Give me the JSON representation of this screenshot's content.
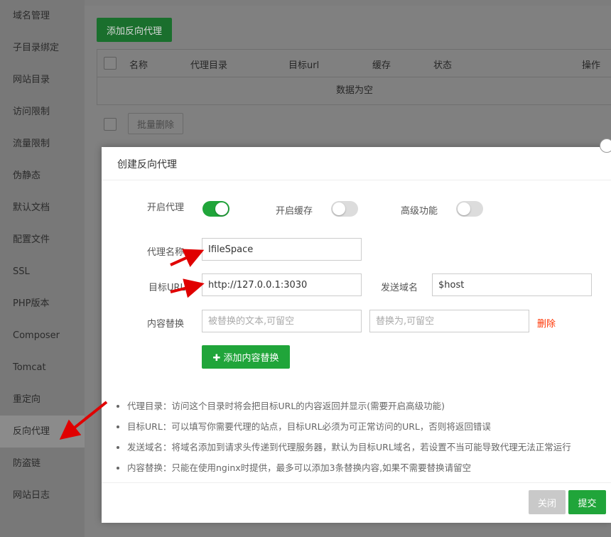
{
  "sidebar": {
    "items": [
      {
        "label": "域名管理"
      },
      {
        "label": "子目录绑定"
      },
      {
        "label": "网站目录"
      },
      {
        "label": "访问限制"
      },
      {
        "label": "流量限制"
      },
      {
        "label": "伪静态"
      },
      {
        "label": "默认文档"
      },
      {
        "label": "配置文件"
      },
      {
        "label": "SSL"
      },
      {
        "label": "PHP版本"
      },
      {
        "label": "Composer"
      },
      {
        "label": "Tomcat"
      },
      {
        "label": "重定向"
      },
      {
        "label": "反向代理"
      },
      {
        "label": "防盗链"
      },
      {
        "label": "网站日志"
      }
    ],
    "active_index": 13
  },
  "toolbar": {
    "add_proxy_label": "添加反向代理"
  },
  "table": {
    "columns": [
      "名称",
      "代理目录",
      "目标url",
      "缓存",
      "状态",
      "操作"
    ],
    "empty_text": "数据为空"
  },
  "batch": {
    "delete_label": "批量删除"
  },
  "dialog": {
    "title": "创建反向代理",
    "enable_proxy": {
      "label": "开启代理",
      "on": true
    },
    "enable_cache": {
      "label": "开启缓存",
      "on": false
    },
    "advanced": {
      "label": "高级功能",
      "on": false
    },
    "proxy_name": {
      "label": "代理名称",
      "value": "IfileSpace"
    },
    "target_url": {
      "label": "目标URL",
      "value": "http://127.0.0.1:3030"
    },
    "send_domain": {
      "label": "发送域名",
      "value": "$host"
    },
    "content_replace": {
      "label": "内容替换",
      "from_placeholder": "被替换的文本,可留空",
      "to_placeholder": "替换为,可留空",
      "delete_label": "删除"
    },
    "add_replace_label": "添加内容替换",
    "notes": [
      "代理目录：访问这个目录时将会把目标URL的内容返回并显示(需要开启高级功能)",
      "目标URL：可以填写你需要代理的站点，目标URL必须为可正常访问的URL，否则将返回错误",
      "发送域名：将域名添加到请求头传递到代理服务器，默认为目标URL域名，若设置不当可能导致代理无法正常运行",
      "内容替换：只能在使用nginx时提供，最多可以添加3条替换内容,如果不需要替换请留空"
    ],
    "close_label": "关闭",
    "submit_label": "提交"
  },
  "colors": {
    "accent_green": "#20a53a",
    "delete_red": "#ff3300",
    "annotation_arrow": "#e00000"
  }
}
